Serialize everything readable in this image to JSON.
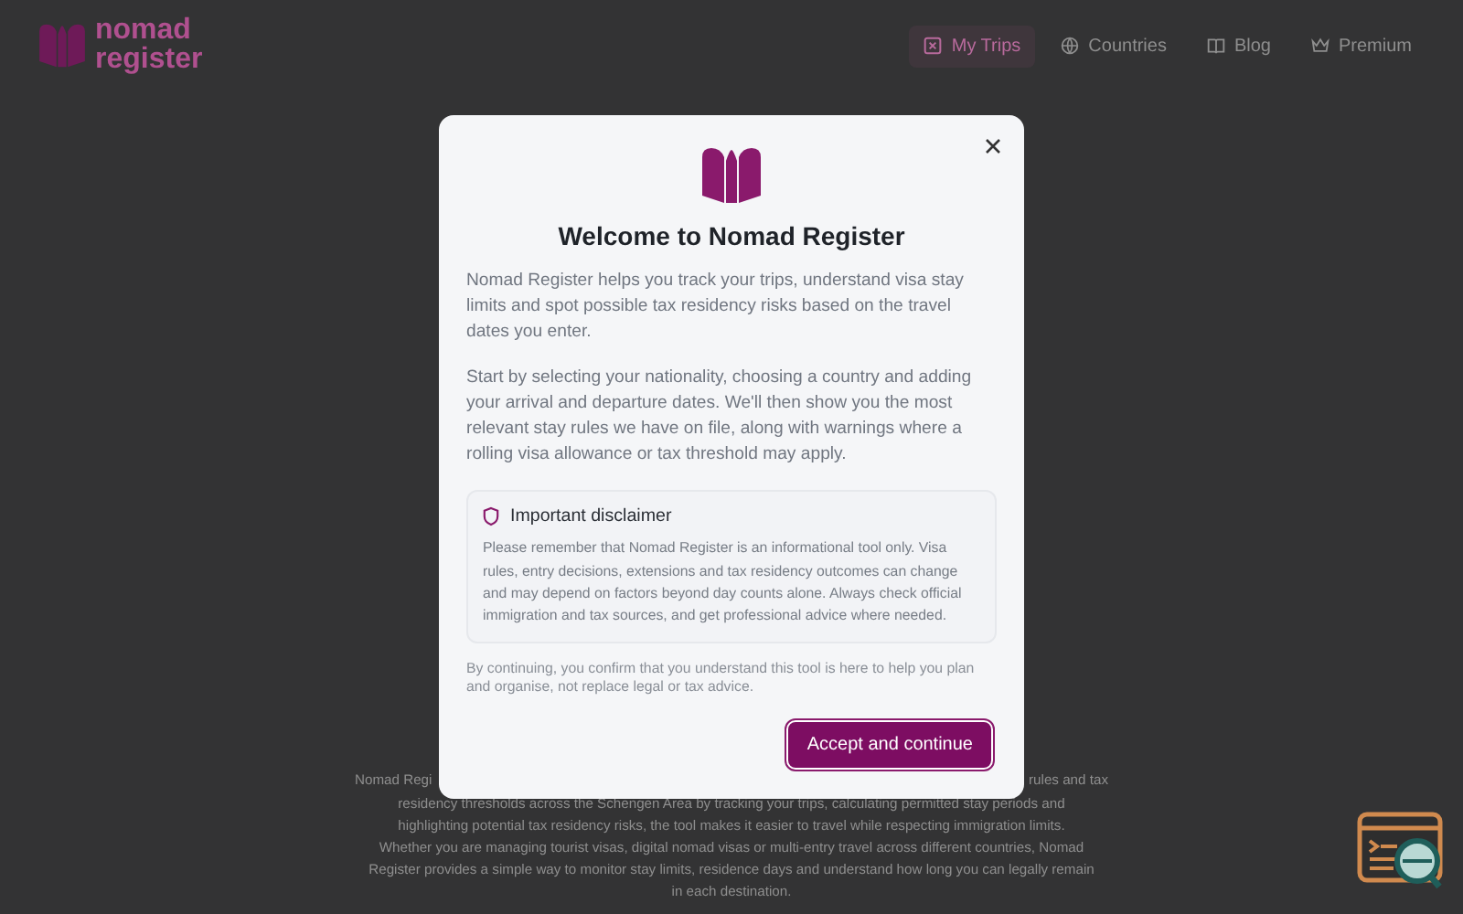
{
  "header": {
    "logo_text": [
      "nomad",
      "register"
    ],
    "nav": [
      {
        "label": "My Trips",
        "selected": true
      },
      {
        "label": "Countries",
        "selected": false
      },
      {
        "label": "Blog",
        "selected": false
      },
      {
        "label": "Premium",
        "selected": false
      }
    ]
  },
  "background": {
    "first_line": [
      "Nomad Regi",
      "rules and tax"
    ],
    "lines": [
      "residency thresholds across the Schengen Area by tracking your trips, calculating permitted stay periods and",
      "highlighting potential tax residency risks, the tool makes it easier to travel while respecting immigration limits.",
      "Whether you are managing tourist visas, digital nomad visas or multi-entry travel across different countries, Nomad",
      "Register provides a simple way to monitor stay limits, residence days and understand how long you can legally remain",
      "in each destination."
    ]
  },
  "modal": {
    "title": "Welcome to Nomad Register",
    "paragraphs": [
      "Nomad Register helps you track your trips, understand visa stay limits and spot possible tax residency risks based on the travel dates you enter.",
      "Start by selecting your nationality, choosing a country and adding your arrival and departure dates. We'll then show you the most relevant stay rules we have on file, along with warnings where a rolling visa allowance or tax threshold may apply."
    ],
    "disclaimer": {
      "title": "Important disclaimer",
      "text": "Please remember that Nomad Register is an informational tool only. Visa rules, entry decisions, extensions and tax residency outcomes can change and may depend on factors beyond day counts alone. Always check official immigration and tax sources, and get professional advice where needed."
    },
    "footnote": "By continuing, you confirm that you understand this tool is here to help you plan and organise, not replace legal or tax advice.",
    "button": "Accept and continue"
  }
}
